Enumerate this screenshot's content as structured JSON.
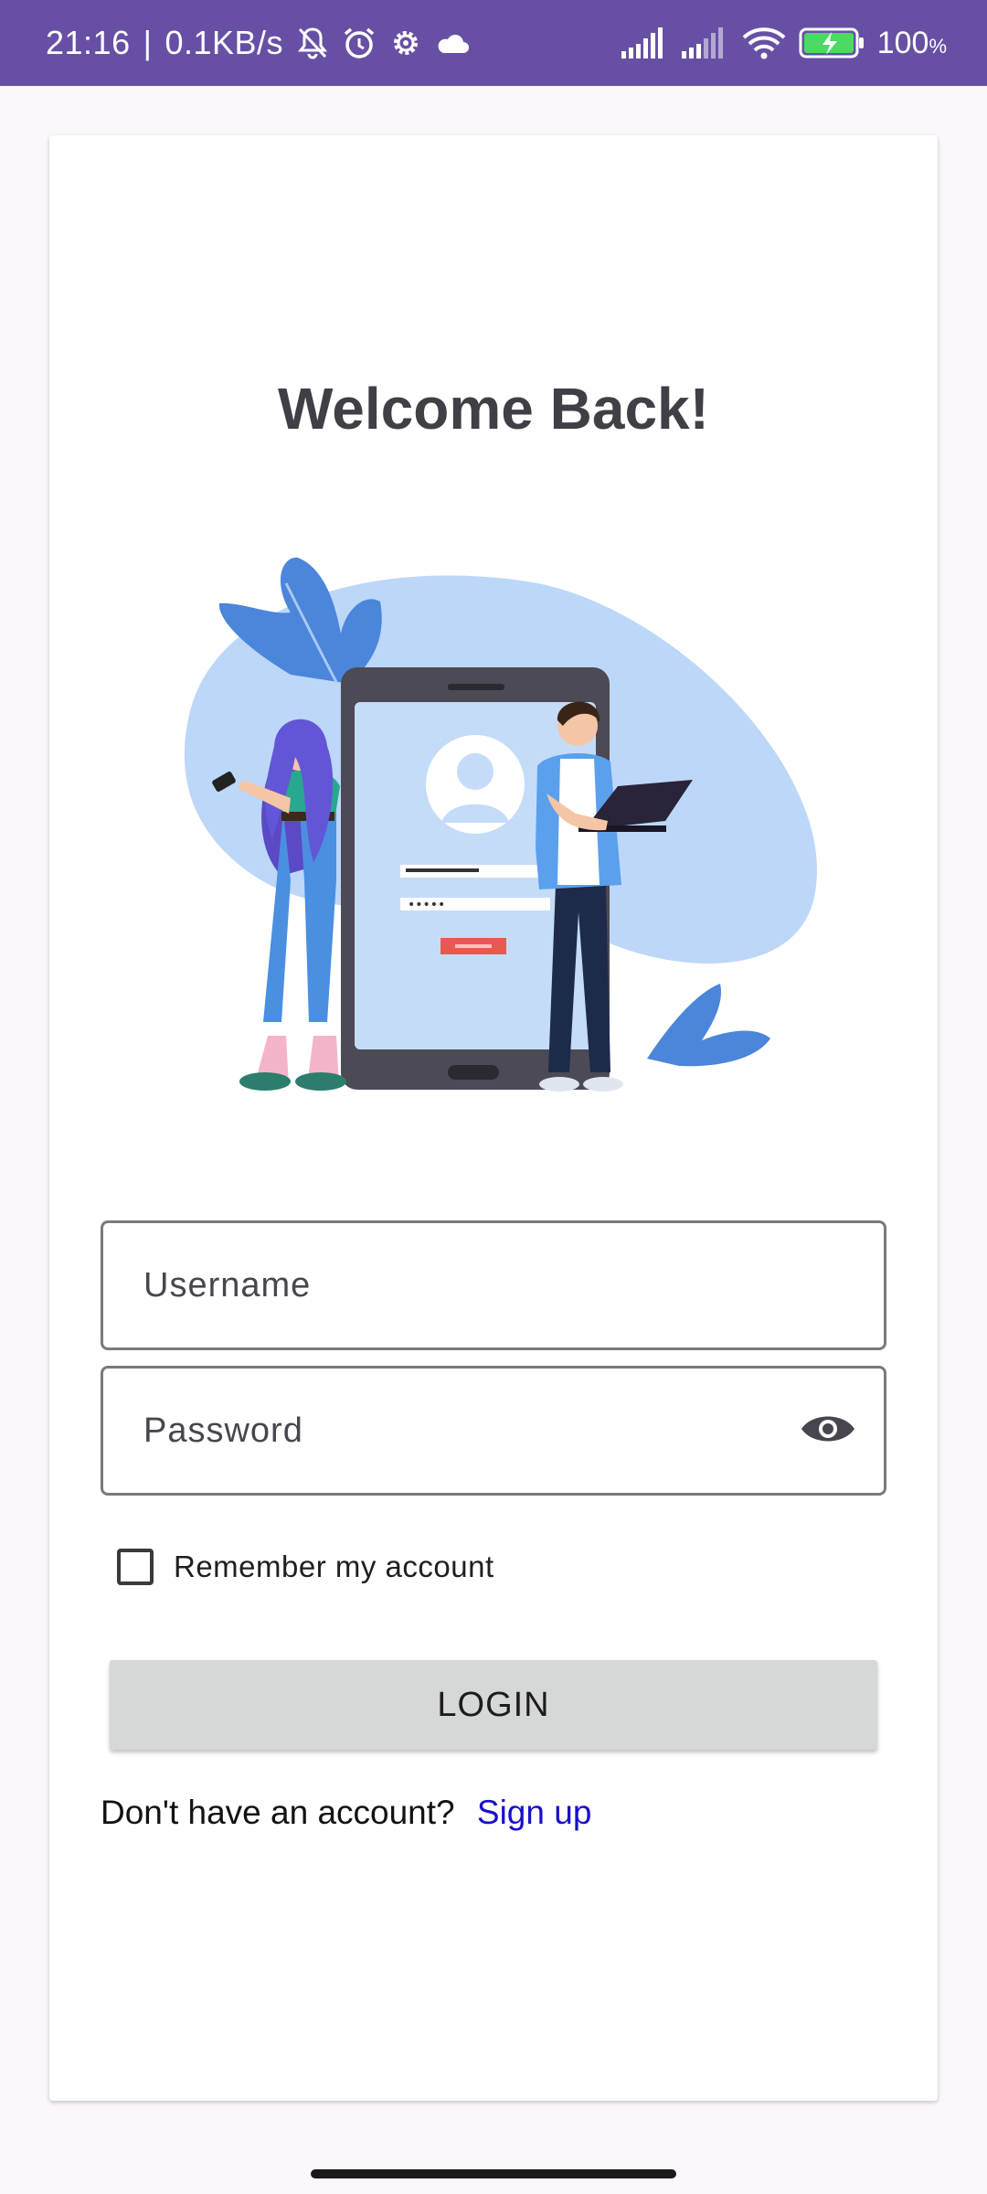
{
  "status_bar": {
    "time": "21:16",
    "network_speed": "0.1KB/s",
    "battery_percent": "100",
    "battery_unit": "%",
    "icons": [
      "notifications-off-icon",
      "alarm-icon",
      "settings-icon",
      "cloud-icon",
      "signal-icon",
      "signal-icon",
      "wifi-icon",
      "battery-charging-icon"
    ]
  },
  "login": {
    "title": "Welcome Back!",
    "username_placeholder": "Username",
    "password_placeholder": "Password",
    "remember_label": "Remember my account",
    "remember_checked": false,
    "login_button": "LOGIN",
    "signup_prompt": "Don't have an account?",
    "signup_link": "Sign up"
  },
  "colors": {
    "status_bar": "#6750a4",
    "background": "#fcf7fd",
    "card": "#ffffff",
    "button": "#d6d8d8",
    "link": "#1a10c8",
    "title": "#3f3f46"
  }
}
